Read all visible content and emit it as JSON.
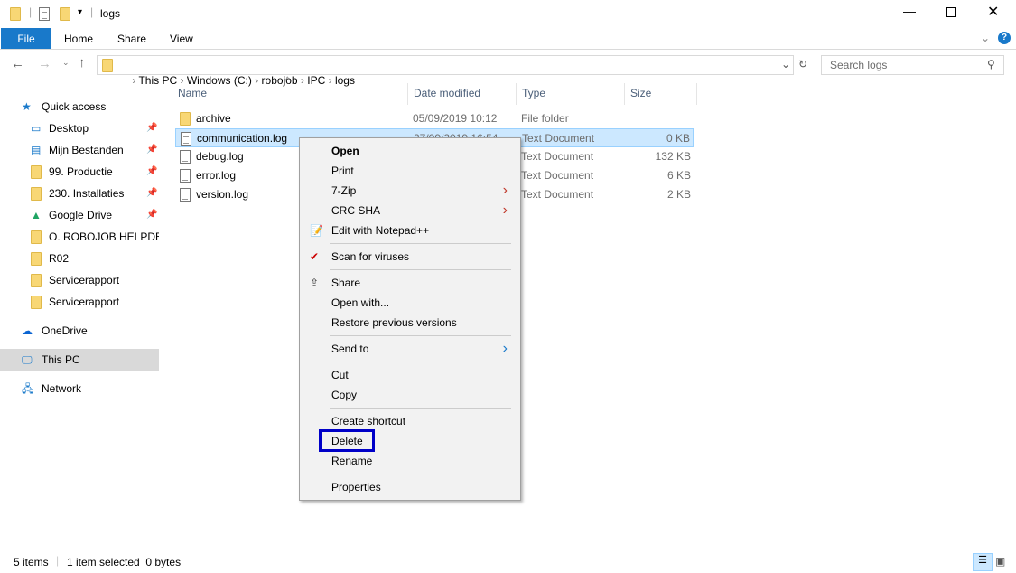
{
  "window": {
    "title": "logs"
  },
  "ribbon": {
    "tabs": [
      "File",
      "Home",
      "Share",
      "View"
    ]
  },
  "address": {
    "path": [
      "This PC",
      "Windows (C:)",
      "robojob",
      "IPC",
      "logs"
    ],
    "search_placeholder": "Search logs"
  },
  "sidebar": {
    "items": [
      {
        "label": "Quick access",
        "icon": "star-icon",
        "pinned": false
      },
      {
        "label": "Desktop",
        "icon": "desktop-icon",
        "pinned": true
      },
      {
        "label": "Mijn Bestanden",
        "icon": "documents-icon",
        "pinned": true
      },
      {
        "label": "99. Productie",
        "icon": "folder-icon",
        "pinned": true
      },
      {
        "label": "230. Installaties",
        "icon": "folder-icon",
        "pinned": true
      },
      {
        "label": "Google Drive",
        "icon": "google-drive-icon",
        "pinned": true
      },
      {
        "label": "O. ROBOJOB HELPDESK",
        "icon": "folder-icon",
        "pinned": false
      },
      {
        "label": "R02",
        "icon": "folder-icon",
        "pinned": false
      },
      {
        "label": "Servicerapport",
        "icon": "folder-icon",
        "pinned": false
      },
      {
        "label": "Servicerapport",
        "icon": "folder-icon",
        "pinned": false
      },
      {
        "label": "OneDrive",
        "icon": "cloud-icon",
        "pinned": false
      },
      {
        "label": "This PC",
        "icon": "computer-icon",
        "pinned": false,
        "selected": true
      },
      {
        "label": "Network",
        "icon": "network-icon",
        "pinned": false
      }
    ]
  },
  "columns": [
    "Name",
    "Date modified",
    "Type",
    "Size"
  ],
  "files": [
    {
      "name": "archive",
      "date": "05/09/2019 10:12",
      "type": "File folder",
      "size": "",
      "icon": "folder-icon"
    },
    {
      "name": "communication.log",
      "date": "27/09/2019 16:54",
      "type": "Text Document",
      "size": "0 KB",
      "icon": "text-file-icon",
      "selected": true
    },
    {
      "name": "debug.log",
      "date": "",
      "type": "Text Document",
      "size": "132 KB",
      "icon": "text-file-icon"
    },
    {
      "name": "error.log",
      "date": "",
      "type": "Text Document",
      "size": "6 KB",
      "icon": "text-file-icon"
    },
    {
      "name": "version.log",
      "date": "",
      "type": "Text Document",
      "size": "2 KB",
      "icon": "text-file-icon"
    }
  ],
  "context_menu": {
    "items": [
      "Open",
      "Print",
      "7-Zip",
      "CRC SHA",
      "Edit with Notepad++",
      "Scan for viruses",
      "Share",
      "Open with...",
      "Restore previous versions",
      "Send to",
      "Cut",
      "Copy",
      "Create shortcut",
      "Delete",
      "Rename",
      "Properties"
    ],
    "highlight_color": "#0000c8"
  },
  "status": {
    "items": "5 items",
    "selection": "1 item selected  0 bytes"
  },
  "colors": {
    "file_tab": "#1979ca",
    "selection": "#cce8ff"
  }
}
